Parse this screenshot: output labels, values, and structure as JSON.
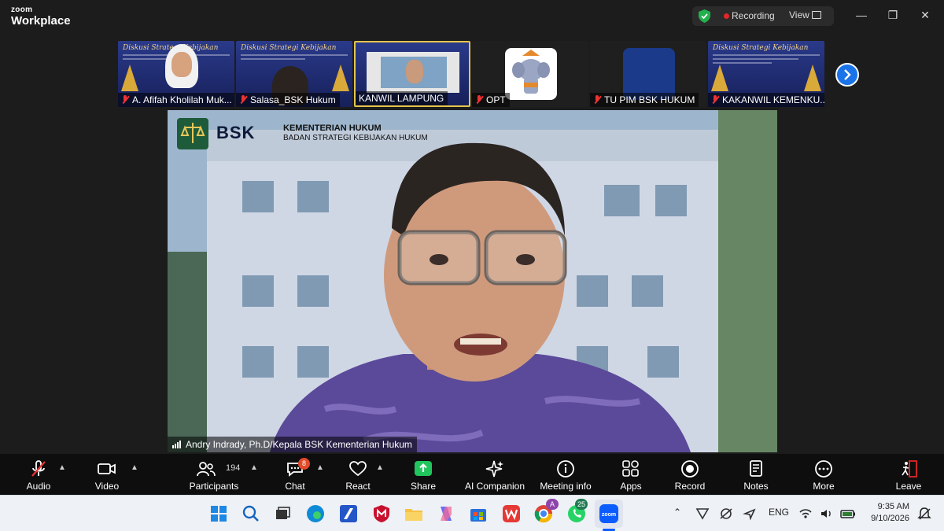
{
  "app": {
    "brand_top": "zoom",
    "brand_bottom": "Workplace"
  },
  "topbar": {
    "recording_label": "Recording",
    "view_label": "View"
  },
  "thumbnails": [
    {
      "name": "A. Afifah Kholilah Muk..."
    },
    {
      "name": "Salasa_BSK Hukum"
    },
    {
      "name": "KANWIL LAMPUNG"
    },
    {
      "name": "OPT"
    },
    {
      "name": "TU PIM BSK HUKUM"
    },
    {
      "name": "KAKANWIL KEMENKU..."
    }
  ],
  "main_video": {
    "speaker": "Andry Indrady, Ph.D/Kepala BSK Kementerian Hukum",
    "background_title": "KEMENTERIAN HUKUM",
    "background_subtitle": "BADAN STRATEGI KEBIJAKAN HUKUM",
    "logo_text": "BSK"
  },
  "toolbar": {
    "audio": "Audio",
    "video": "Video",
    "participants": "Participants",
    "participants_count": "194",
    "chat": "Chat",
    "chat_badge": "8",
    "react": "React",
    "share": "Share",
    "ai_companion": "AI Companion",
    "meeting_info": "Meeting info",
    "apps": "Apps",
    "record": "Record",
    "notes": "Notes",
    "more": "More",
    "leave": "Leave"
  },
  "taskbar": {
    "lang": "ENG",
    "time": "9:35 AM",
    "date": "9/10/2026",
    "whatsapp_badge": "25",
    "chrome_badge": "A"
  },
  "colors": {
    "accent_blue": "#1a73e8",
    "share_green": "#21c55d",
    "record_red": "#e02828"
  }
}
